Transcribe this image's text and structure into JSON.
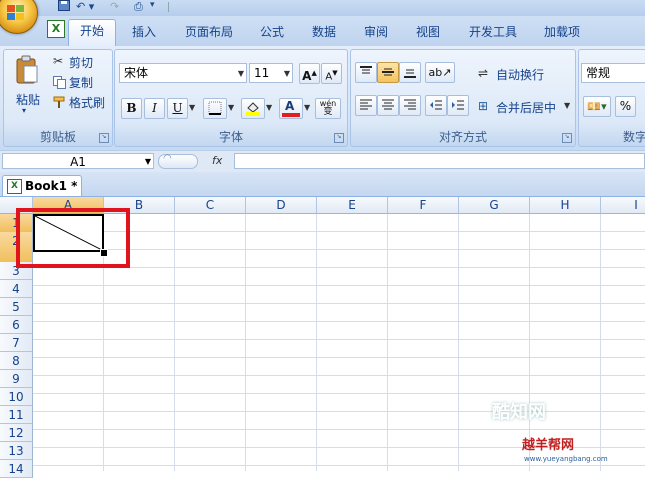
{
  "tabs": [
    {
      "label": "开始",
      "active": true
    },
    {
      "label": "插入"
    },
    {
      "label": "页面布局"
    },
    {
      "label": "公式"
    },
    {
      "label": "数据"
    },
    {
      "label": "审阅"
    },
    {
      "label": "视图"
    },
    {
      "label": "开发工具"
    },
    {
      "label": "加载项"
    }
  ],
  "ribbon": {
    "clipboard": {
      "paste_label": "粘贴",
      "cut_label": "剪切",
      "copy_label": "复制",
      "format_painter_label": "格式刷",
      "group_label": "剪贴板"
    },
    "font": {
      "font_name": "宋体",
      "font_size": "11",
      "bold": "B",
      "italic": "I",
      "underline": "U",
      "font_color_glyph": "A",
      "phonetic_glyph": "wén",
      "phonetic_glyph2": "变",
      "grow_glyph": "A",
      "shrink_glyph": "A",
      "group_label": "字体"
    },
    "alignment": {
      "wrap_text_label": "自动换行",
      "merge_center_label": "合并后居中",
      "group_label": "对齐方式"
    },
    "number": {
      "format_value": "常规",
      "percent_glyph": "%",
      "group_label": "数字"
    }
  },
  "formula_bar": {
    "name_box": "A1",
    "fx_label": "fx",
    "formula": ""
  },
  "workbook_tab": "Book1 *",
  "columns": [
    "A",
    "B",
    "C",
    "D",
    "E",
    "F",
    "G",
    "H",
    "I"
  ],
  "rows": [
    "1",
    "2",
    "3",
    "4",
    "5",
    "6",
    "7",
    "8",
    "9",
    "10",
    "11",
    "12",
    "13",
    "14"
  ],
  "selected_cell": "A1",
  "watermark": {
    "line1": "酷知网",
    "line2": "越羊帮网",
    "line3": "www.yueyangbang.com"
  },
  "colors": {
    "highlight_frame": "#e0141c",
    "ribbon_bg": "#dbe7f7",
    "header_selected": "#f6cd7e",
    "font_color_bar": "#e02020",
    "fill_color_bar": "#ffff00"
  }
}
